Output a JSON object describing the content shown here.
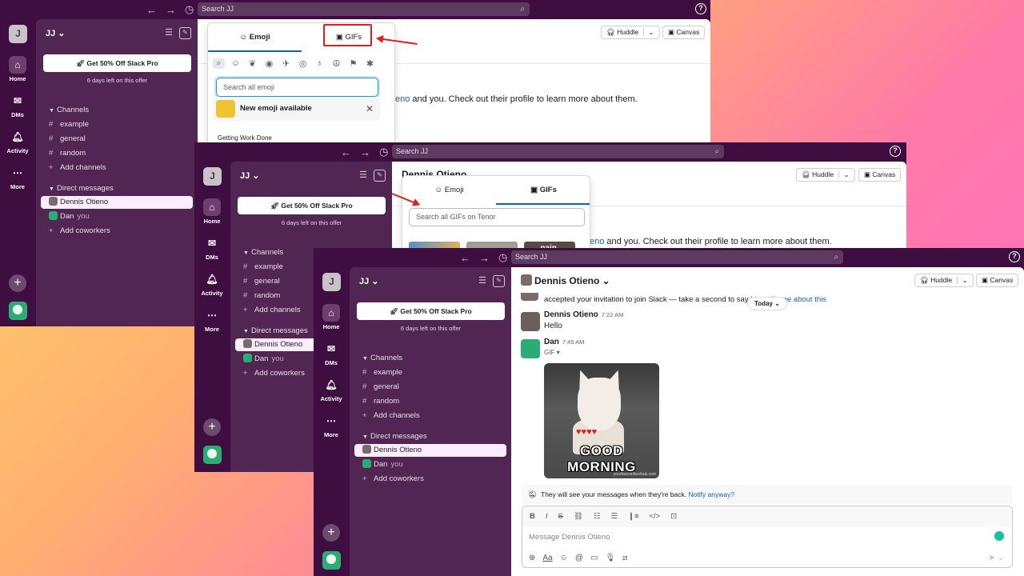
{
  "common": {
    "search_placeholder": "Search JJ",
    "workspace_initial": "J",
    "workspace_name": "JJ",
    "rail": {
      "home": "Home",
      "dms": "DMs",
      "activity": "Activity",
      "more": "More"
    },
    "promo": "Get 50% Off Slack Pro",
    "promo_sub": "6 days left on this offer",
    "channels_header": "Channels",
    "channels": [
      "example",
      "general",
      "random"
    ],
    "add_channels": "Add channels",
    "dm_header": "Direct messages",
    "dm_contact": "Dennis Otieno",
    "dm_self": "Dan",
    "dm_self_tag": "you",
    "add_coworkers": "Add coworkers",
    "huddle": "Huddle",
    "canvas": "Canvas",
    "help": "?"
  },
  "window1": {
    "picker": {
      "tab_emoji": "Emoji",
      "tab_gifs": "GIFs",
      "search_placeholder": "Search all emoji",
      "new_emoji": "New emoji available",
      "section": "Getting Work Done"
    },
    "message": {
      "link": "eno",
      "rest": "and you. Check out their profile to learn more about them."
    }
  },
  "window2": {
    "channel_title": "Dennis Otieno",
    "picker": {
      "tab_emoji": "Emoji",
      "tab_gifs": "GIFs",
      "search_placeholder": "Search all GIFs on Tenor",
      "thumb_text": "pain."
    },
    "message": {
      "link": "eno",
      "rest": "and you. Check out their profile to learn more about them."
    }
  },
  "window3": {
    "channel_title": "Dennis Otieno",
    "system_msg": "accepted your invitation to join Slack — take a second to say h",
    "system_link": "'t notify me about this",
    "today": "Today",
    "msg1": {
      "author": "Dennis Otieno",
      "time": "7:22 AM",
      "text": "Hello"
    },
    "msg2": {
      "author": "Dan",
      "time": "7:45 AM",
      "label": "GIF"
    },
    "gif": {
      "line1": "GOOD",
      "line2": "MORNING",
      "watermark": "yourfaceonfacebuk.com"
    },
    "notice": {
      "text": "They will see your messages when they're back.",
      "link": "Notify anyway?"
    },
    "composer": {
      "placeholder": "Message Dennis Otieno"
    }
  }
}
